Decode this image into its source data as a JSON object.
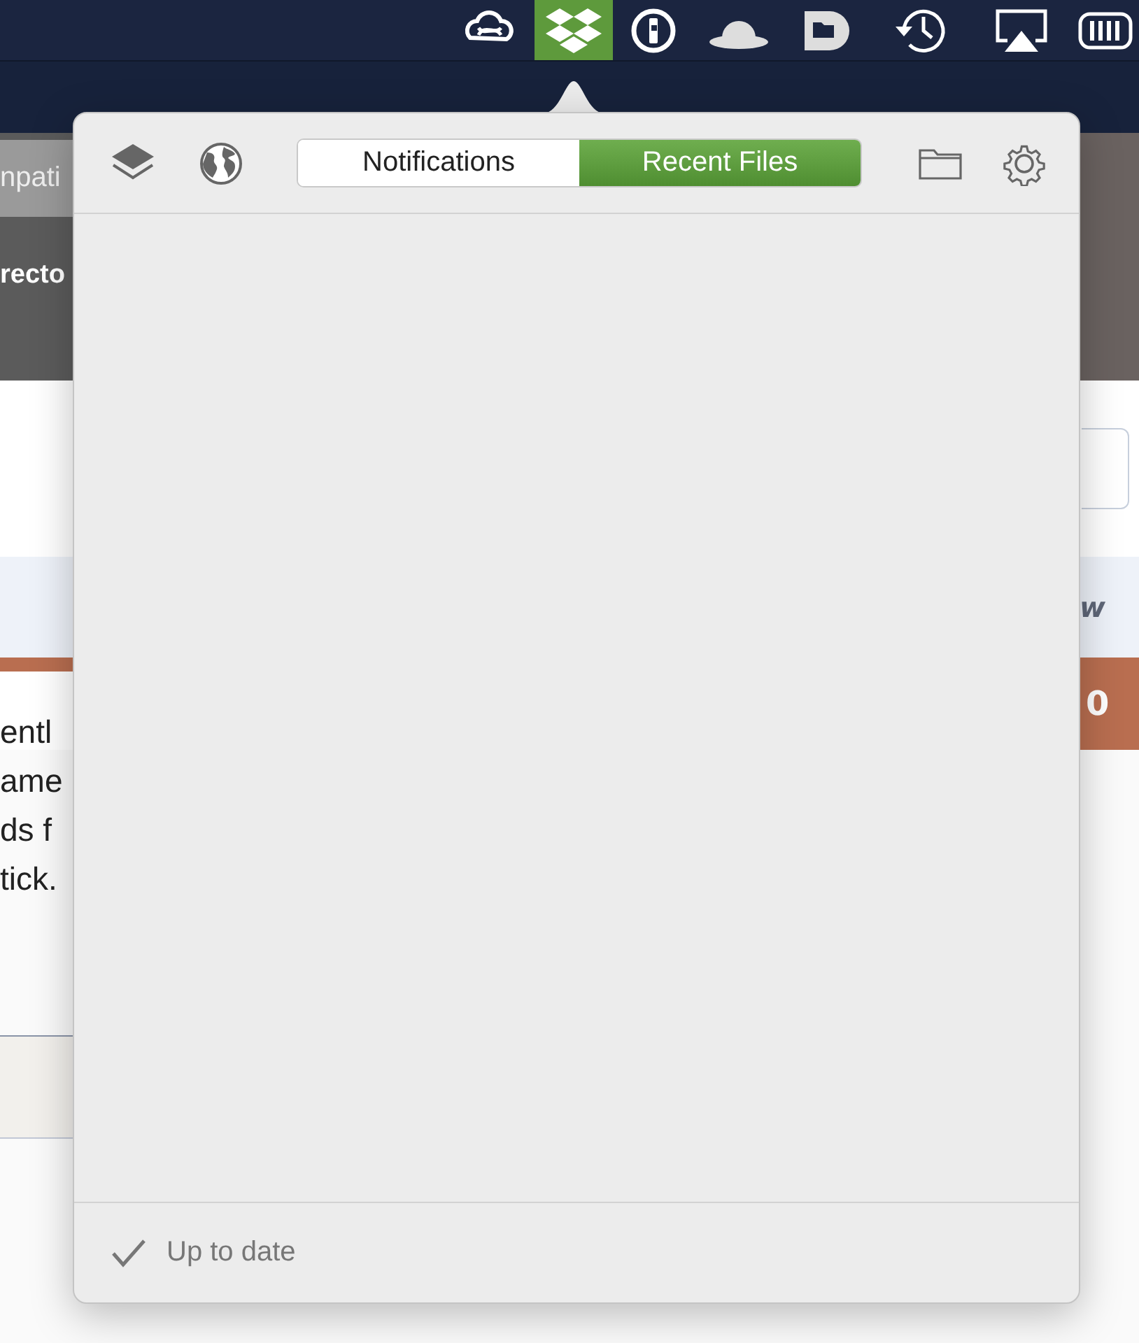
{
  "menu_bar": {
    "items": [
      {
        "kind": "cloud",
        "selected": false
      },
      {
        "kind": "dropbox",
        "selected": true
      },
      {
        "kind": "password",
        "selected": false
      },
      {
        "kind": "hat",
        "selected": false
      },
      {
        "kind": "tag",
        "selected": false
      },
      {
        "kind": "time",
        "selected": false
      },
      {
        "kind": "airplay",
        "selected": false
      },
      {
        "kind": "battery",
        "selected": false
      }
    ]
  },
  "background_page": {
    "toolbar_texts": [
      "npati",
      "recto"
    ],
    "band_text": "w",
    "badge": "0",
    "paragraph_lines": [
      "entl",
      "ame",
      "ds f",
      "tick."
    ]
  },
  "popover": {
    "tabs": [
      {
        "label": "Notifications",
        "selected": false
      },
      {
        "label": "Recent Files",
        "selected": true
      }
    ],
    "status": "Up to date"
  }
}
